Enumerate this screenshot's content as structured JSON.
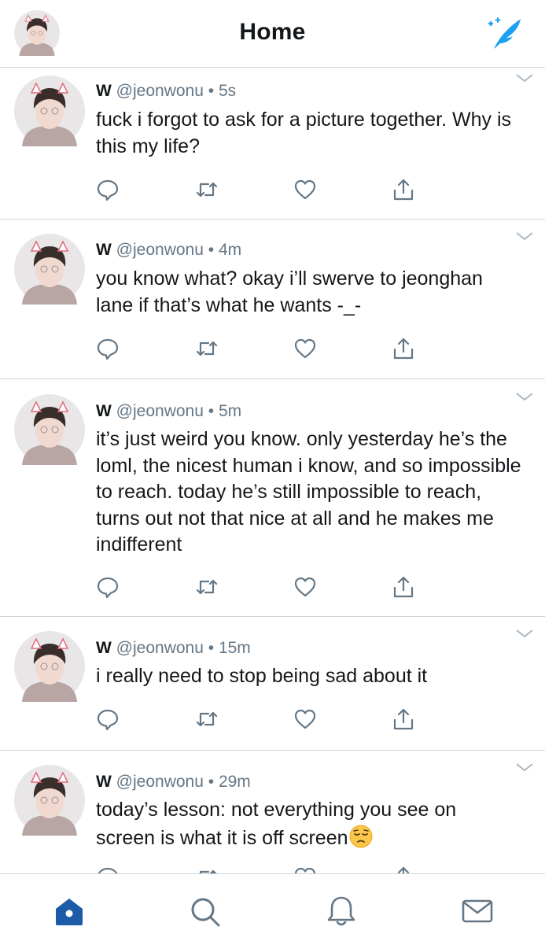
{
  "header": {
    "title": "Home",
    "accent_color": "#1da1f2"
  },
  "tweets": [
    {
      "name": "W",
      "handle": "@jeonwonu",
      "dot": "•",
      "time": "5s",
      "text": "fuck i forgot to ask for a picture together. Why is this my life?"
    },
    {
      "name": "W",
      "handle": "@jeonwonu",
      "dot": "•",
      "time": "4m",
      "text": "you know what? okay i’ll swerve to jeonghan lane if that’s what he wants -_-"
    },
    {
      "name": "W",
      "handle": "@jeonwonu",
      "dot": "•",
      "time": "5m",
      "text": "it’s just weird you know. only yesterday he’s the loml, the nicest human i know, and so impossible to reach. today he’s still impossible to reach, turns out not that nice at all and he makes me indifferent"
    },
    {
      "name": "W",
      "handle": "@jeonwonu",
      "dot": "•",
      "time": "15m",
      "text": "i really need to stop being sad about it"
    },
    {
      "name": "W",
      "handle": "@jeonwonu",
      "dot": "•",
      "time": "29m",
      "text": "today’s lesson: not everything you see on screen is what it is off screen",
      "emoji": "pensive-face"
    }
  ],
  "icons": {
    "compose": "compose-tweet-icon",
    "reply": "reply-icon",
    "retweet": "retweet-icon",
    "like": "heart-icon",
    "share": "share-icon",
    "caret": "chevron-down-icon"
  },
  "tabbar": {
    "items": [
      "home-icon",
      "search-icon",
      "notifications-icon",
      "messages-icon"
    ],
    "active": "home-icon",
    "active_color": "#1d5ba8",
    "inactive_color": "#657786"
  }
}
